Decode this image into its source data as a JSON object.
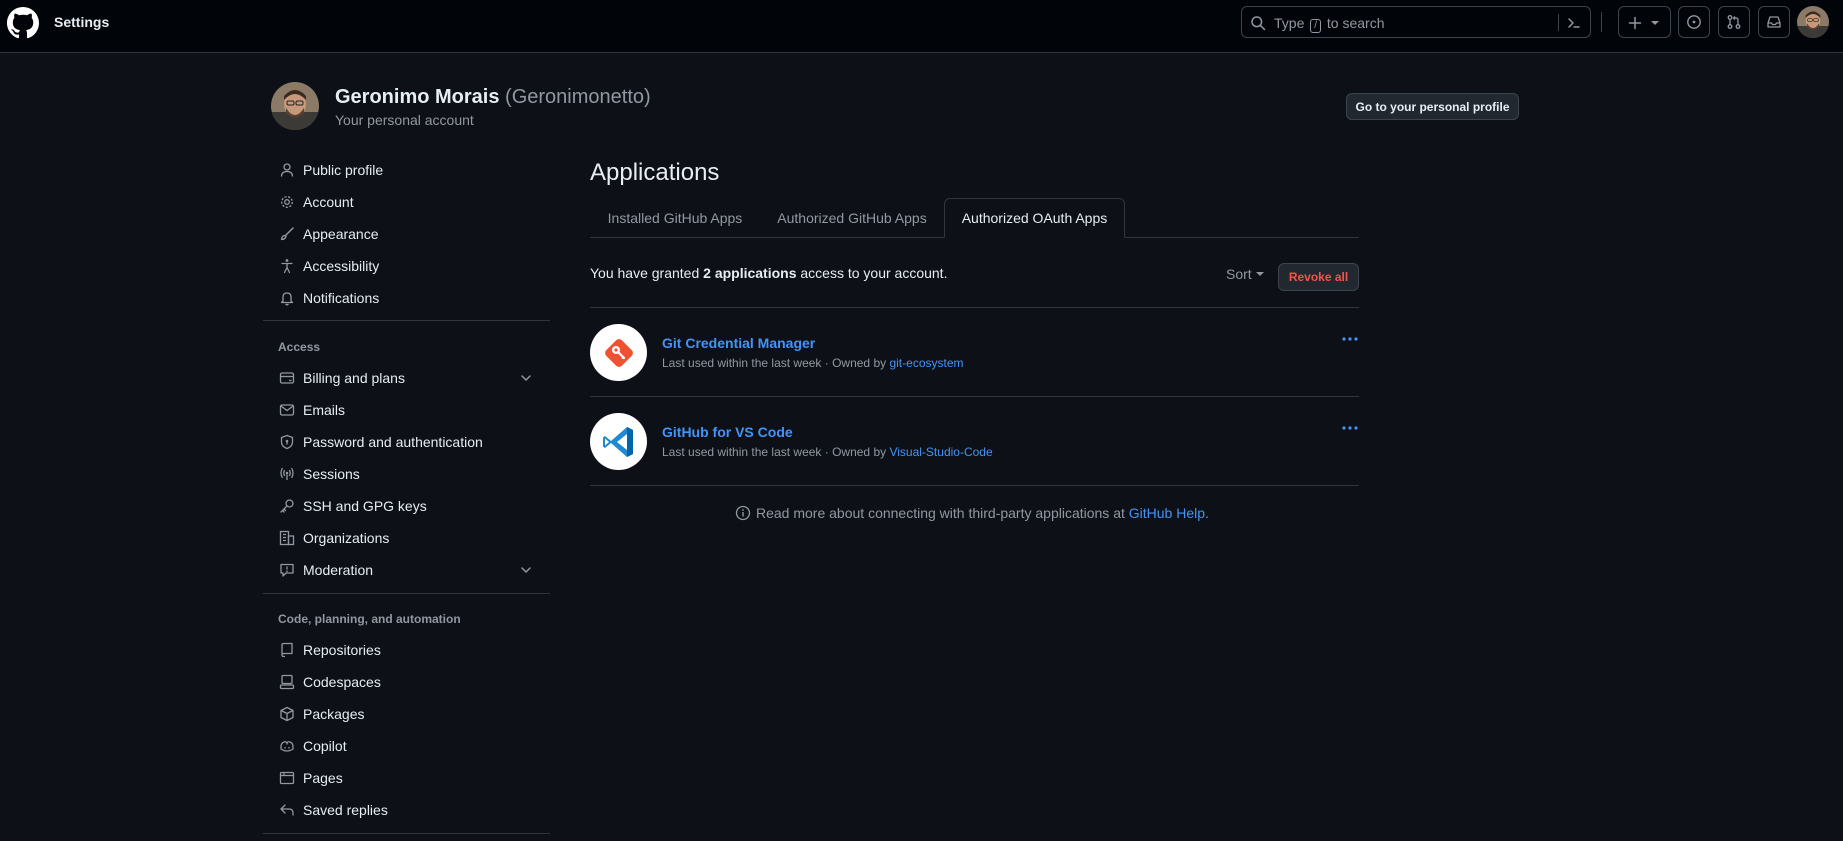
{
  "header": {
    "title": "Settings",
    "search_before": "Type",
    "search_key": "/",
    "search_after": "to search"
  },
  "profile": {
    "name": "Geronimo Morais",
    "login": "(Geronimonetto)",
    "subtitle": "Your personal account",
    "go_profile_label": "Go to your personal profile"
  },
  "sidebar": {
    "items": [
      {
        "label": "Public profile",
        "icon": "person-icon"
      },
      {
        "label": "Account",
        "icon": "gear-icon"
      },
      {
        "label": "Appearance",
        "icon": "paintbrush-icon"
      },
      {
        "label": "Accessibility",
        "icon": "accessibility-icon"
      },
      {
        "label": "Notifications",
        "icon": "bell-icon"
      }
    ],
    "access_heading": "Access",
    "access_items": [
      {
        "label": "Billing and plans",
        "icon": "credit-card-icon"
      },
      {
        "label": "Emails",
        "icon": "mail-icon"
      },
      {
        "label": "Password and authentication",
        "icon": "shield-lock-icon"
      },
      {
        "label": "Sessions",
        "icon": "broadcast-icon"
      },
      {
        "label": "SSH and GPG keys",
        "icon": "key-icon"
      },
      {
        "label": "Organizations",
        "icon": "organization-icon"
      },
      {
        "label": "Moderation",
        "icon": "report-icon"
      }
    ],
    "code_heading": "Code, planning, and automation",
    "code_items": [
      {
        "label": "Repositories",
        "icon": "repo-icon"
      },
      {
        "label": "Codespaces",
        "icon": "codespaces-icon"
      },
      {
        "label": "Packages",
        "icon": "package-icon"
      },
      {
        "label": "Copilot",
        "icon": "copilot-icon"
      },
      {
        "label": "Pages",
        "icon": "browser-icon"
      },
      {
        "label": "Saved replies",
        "icon": "reply-icon"
      }
    ]
  },
  "main": {
    "title": "Applications",
    "tabs": [
      {
        "label": "Installed GitHub Apps",
        "selected": false
      },
      {
        "label": "Authorized GitHub Apps",
        "selected": false
      },
      {
        "label": "Authorized OAuth Apps",
        "selected": true
      }
    ],
    "granted_before": "You have granted",
    "granted_count": "2 applications",
    "granted_after": "access to your account.",
    "sort_label": "Sort",
    "revoke_all_label": "Revoke all",
    "apps": [
      {
        "name": "Git Credential Manager",
        "meta": "Last used within the last week · Owned by",
        "owner": "git-ecosystem",
        "logo": "git-credential-manager-logo"
      },
      {
        "name": "GitHub for VS Code",
        "meta": "Last used within the last week · Owned by",
        "owner": "Visual-Studio-Code",
        "logo": "vscode-logo"
      }
    ],
    "help_before": "Read more about connecting with third-party applications at",
    "help_link": "GitHub Help",
    "help_after": "."
  },
  "colors": {
    "background": "#0d1117",
    "header": "#010409",
    "accent_link": "#4493f8",
    "danger": "#f85149",
    "muted_text": "#9198a1",
    "border": "#30363d"
  }
}
